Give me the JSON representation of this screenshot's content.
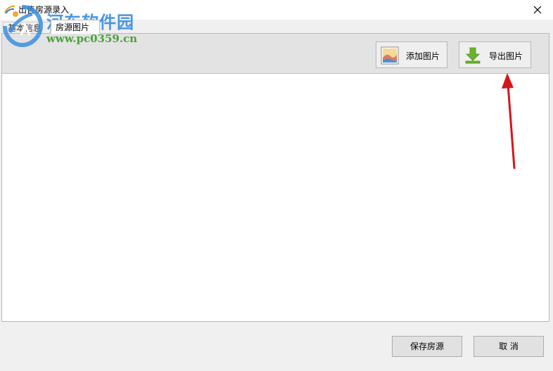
{
  "window": {
    "title": "出售房源录入",
    "close_glyph": "✕"
  },
  "tabs": [
    {
      "label": "基本信息",
      "active": false
    },
    {
      "label": "房源图片",
      "active": true
    }
  ],
  "toolbar": {
    "add_image_label": "添加图片",
    "add_image_icon": "image-icon",
    "export_image_label": "导出图片",
    "export_image_icon": "download-arrow-icon"
  },
  "footer": {
    "save_label": "保存房源",
    "cancel_label": "取 消"
  },
  "watermark": {
    "site_name": "河东软件园",
    "url": "www.pc0359.cn"
  },
  "colors": {
    "accent_blue": "#3a8ee0",
    "watermark_green": "#4aa23a",
    "annotation_red": "#d8141c",
    "export_icon_green": "#6ab42d"
  }
}
